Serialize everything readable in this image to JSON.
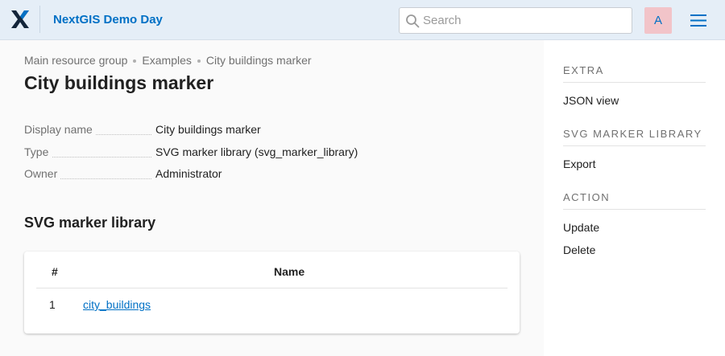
{
  "header": {
    "app_title": "NextGIS Demo Day",
    "search_placeholder": "Search",
    "avatar_initial": "A",
    "brand_color": "#0070c5"
  },
  "breadcrumb": [
    "Main resource group",
    "Examples",
    "City buildings marker"
  ],
  "page_title": "City buildings marker",
  "properties": [
    {
      "label": "Display name",
      "value": "City buildings marker"
    },
    {
      "label": "Type",
      "value": "SVG marker library (svg_marker_library)"
    },
    {
      "label": "Owner",
      "value": "Administrator"
    }
  ],
  "library": {
    "title": "SVG marker library",
    "columns": [
      "#",
      "Name"
    ],
    "rows": [
      {
        "num": "1",
        "name": "city_buildings"
      }
    ]
  },
  "sidebar": {
    "sections": [
      {
        "heading": "EXTRA",
        "items": [
          "JSON view"
        ]
      },
      {
        "heading": "SVG MARKER LIBRARY",
        "items": [
          "Export"
        ]
      },
      {
        "heading": "ACTION",
        "items": [
          "Update",
          "Delete"
        ]
      }
    ]
  }
}
